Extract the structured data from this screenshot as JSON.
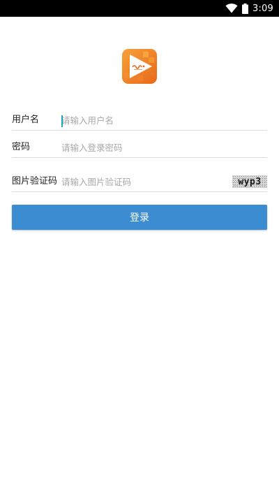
{
  "status_bar": {
    "time": "3:09",
    "icons": [
      "wifi-icon",
      "battery-icon"
    ]
  },
  "app": {
    "logo_icon": "video-play-logo",
    "colors": {
      "accent": "#3b8cd0",
      "logo_orange": "#f08a24"
    }
  },
  "form": {
    "username": {
      "label": "用户名",
      "placeholder": "请输入用户名",
      "value": ""
    },
    "password": {
      "label": "密码",
      "placeholder": "请输入登录密码",
      "value": ""
    },
    "captcha": {
      "label": "图片验证码",
      "placeholder": "请输入图片验证码",
      "value": "",
      "image_text": "wyp3"
    }
  },
  "login_button": {
    "label": "登录"
  }
}
